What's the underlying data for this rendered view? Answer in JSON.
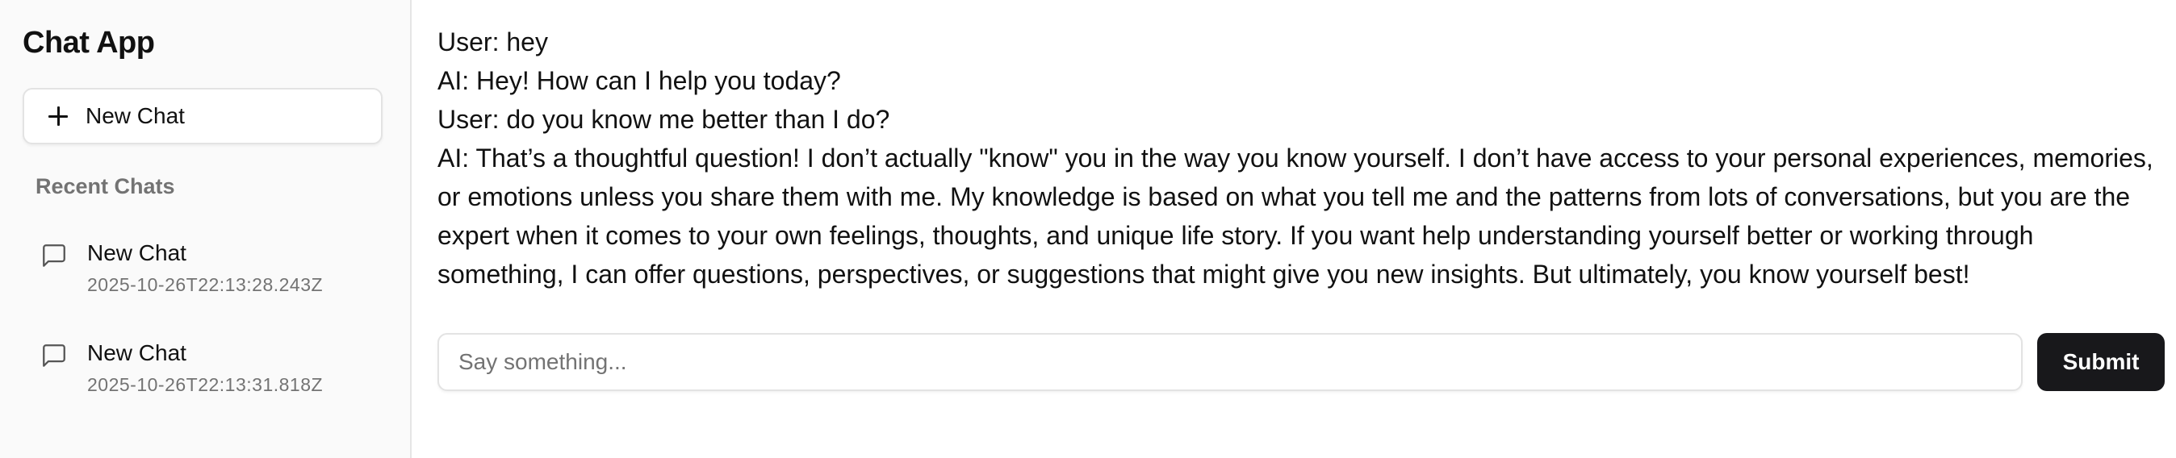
{
  "sidebar": {
    "app_title": "Chat App",
    "new_chat_label": "New Chat",
    "recent_label": "Recent Chats",
    "chats": [
      {
        "title": "New Chat",
        "timestamp": "2025-10-26T22:13:28.243Z"
      },
      {
        "title": "New Chat",
        "timestamp": "2025-10-26T22:13:31.818Z"
      }
    ]
  },
  "messages": [
    {
      "text": "User: hey"
    },
    {
      "text": "AI: Hey! How can I help you today?"
    },
    {
      "text": "User: do you know me better than I do?"
    },
    {
      "text": "AI: That’s a thoughtful question! I don’t actually \"know\" you in the way you know yourself. I don’t have access to your personal experiences, memories, or emotions unless you share them with me. My knowledge is based on what you tell me and the patterns from lots of conversations, but you are the expert when it comes to your own feelings, thoughts, and unique life story. If you want help understanding yourself better or working through something, I can offer questions, perspectives, or suggestions that might give you new insights. But ultimately, you know yourself best!"
    }
  ],
  "composer": {
    "placeholder": "Say something...",
    "value": "",
    "submit_label": "Submit"
  },
  "icons": {
    "new_chat": "plus-icon",
    "chat_item": "message-square-icon"
  },
  "colors": {
    "primary_button": "#18181b",
    "muted_text": "#737373",
    "sidebar_bg": "#fafafa",
    "border": "#e3e3e3"
  }
}
